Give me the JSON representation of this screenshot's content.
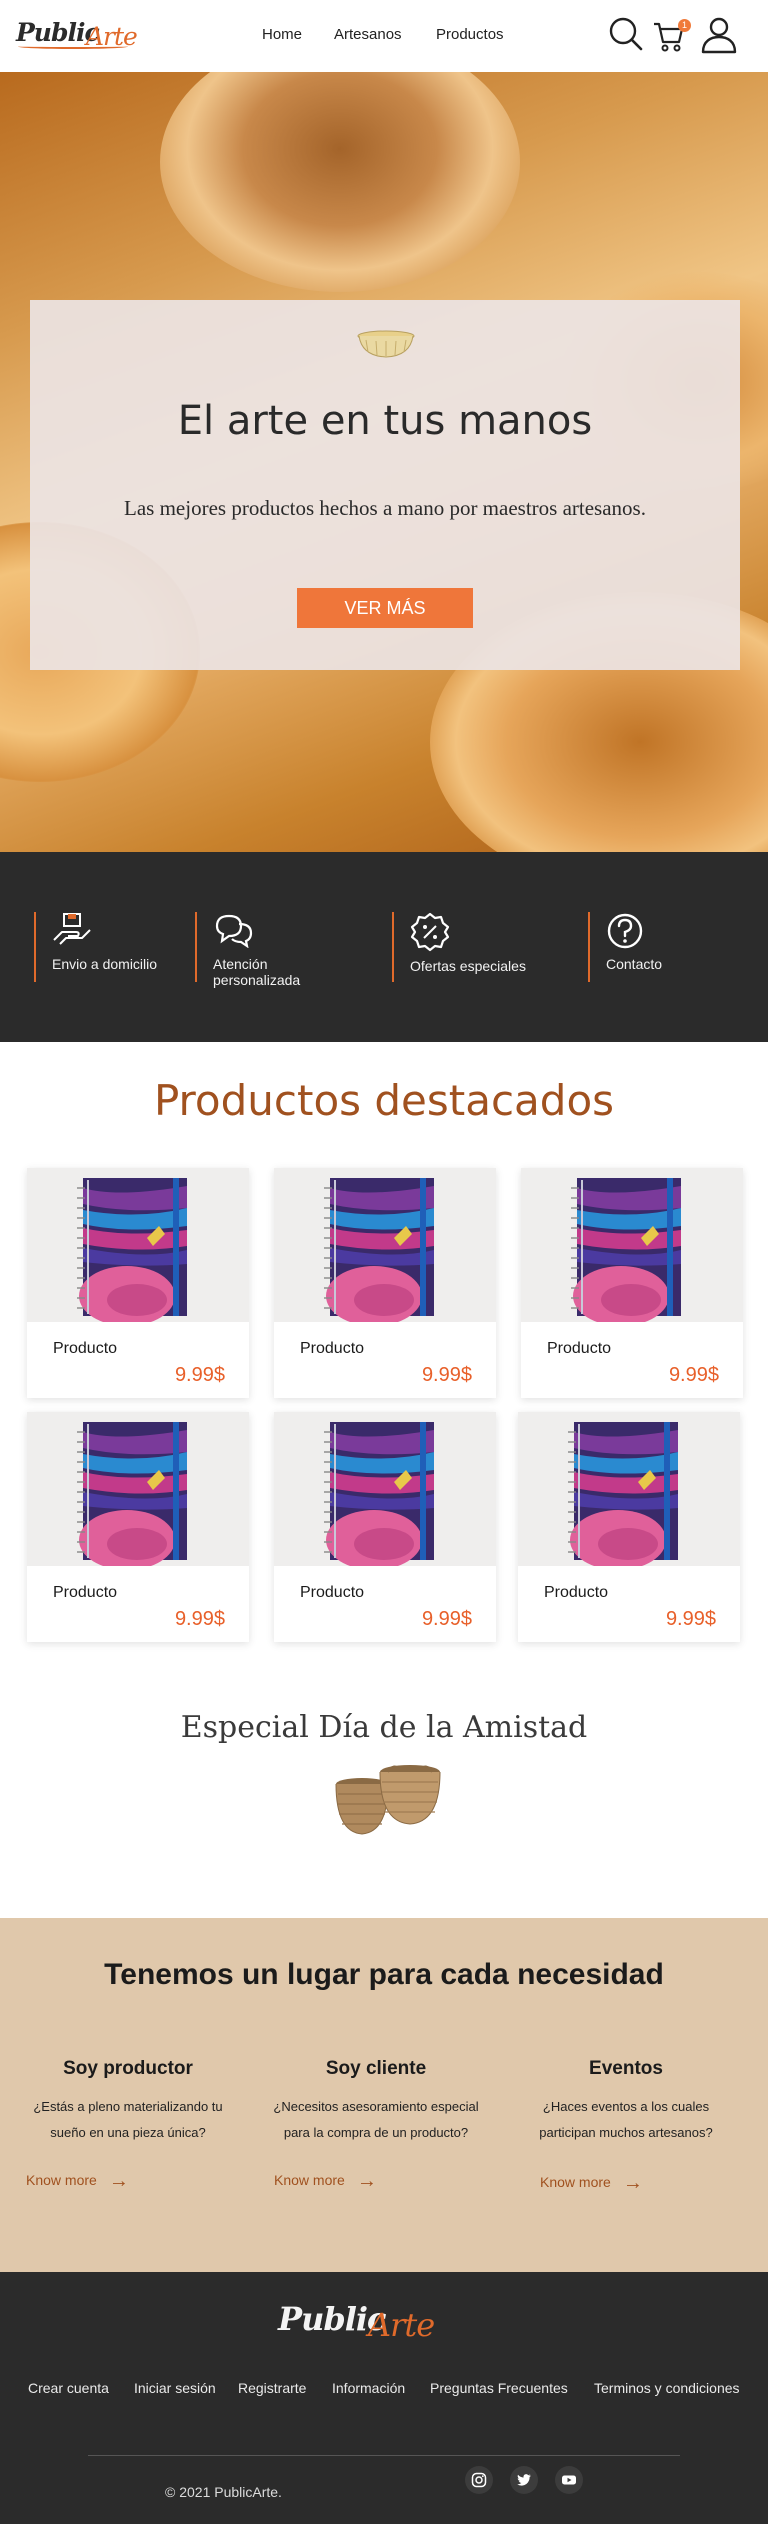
{
  "header": {
    "logo_part1": "Public",
    "logo_part2": "Arte",
    "nav": [
      "Home",
      "Artesanos",
      "Productos"
    ],
    "cart_count": "1",
    "icons": [
      "search-icon",
      "cart-icon",
      "user-icon"
    ]
  },
  "hero": {
    "title": "El arte en tus manos",
    "subtitle": "Las mejores productos hechos a mano por maestros artesanos.",
    "button": "VER MÁS"
  },
  "features": [
    {
      "label": "Envio a domicilio",
      "icon": "delivery-hand-icon"
    },
    {
      "label": "Atención personalizada",
      "icon": "chat-bubbles-icon"
    },
    {
      "label": "Ofertas especiales",
      "icon": "discount-badge-icon"
    },
    {
      "label": "Contacto",
      "icon": "question-circle-icon"
    }
  ],
  "featured": {
    "title": "Productos destacados",
    "products": [
      {
        "name": "Producto",
        "price": "9.99$"
      },
      {
        "name": "Producto",
        "price": "9.99$"
      },
      {
        "name": "Producto",
        "price": "9.99$"
      },
      {
        "name": "Producto",
        "price": "9.99$"
      },
      {
        "name": "Producto",
        "price": "9.99$"
      },
      {
        "name": "Producto",
        "price": "9.99$"
      }
    ]
  },
  "special": {
    "title": "Especial Día de la Amistad"
  },
  "needs": {
    "title": "Tenemos un lugar para cada necesidad",
    "columns": [
      {
        "heading": "Soy productor",
        "text": "¿Estás a pleno materializando tu sueño en una pieza única?",
        "link": "Know more"
      },
      {
        "heading": "Soy cliente",
        "text": "¿Necesitos asesoramiento especial para la compra de un producto?",
        "link": "Know more"
      },
      {
        "heading": "Eventos",
        "text": "¿Haces eventos a los cuales participan muchos artesanos?",
        "link": "Know more"
      }
    ]
  },
  "footer": {
    "logo_part1": "Public",
    "logo_part2": "Arte",
    "links": [
      "Crear cuenta",
      "Iniciar sesión",
      "Registrarte",
      "Información",
      "Preguntas Frecuentes",
      "Terminos y condiciones"
    ],
    "copyright": "© 2021 PublicArte.",
    "social": [
      "instagram-icon",
      "twitter-icon",
      "youtube-icon"
    ]
  },
  "colors": {
    "accent": "#ef763a",
    "brand_brown": "#a0511f",
    "dark": "#2b2b2b",
    "sand": "#e0c8ab"
  }
}
